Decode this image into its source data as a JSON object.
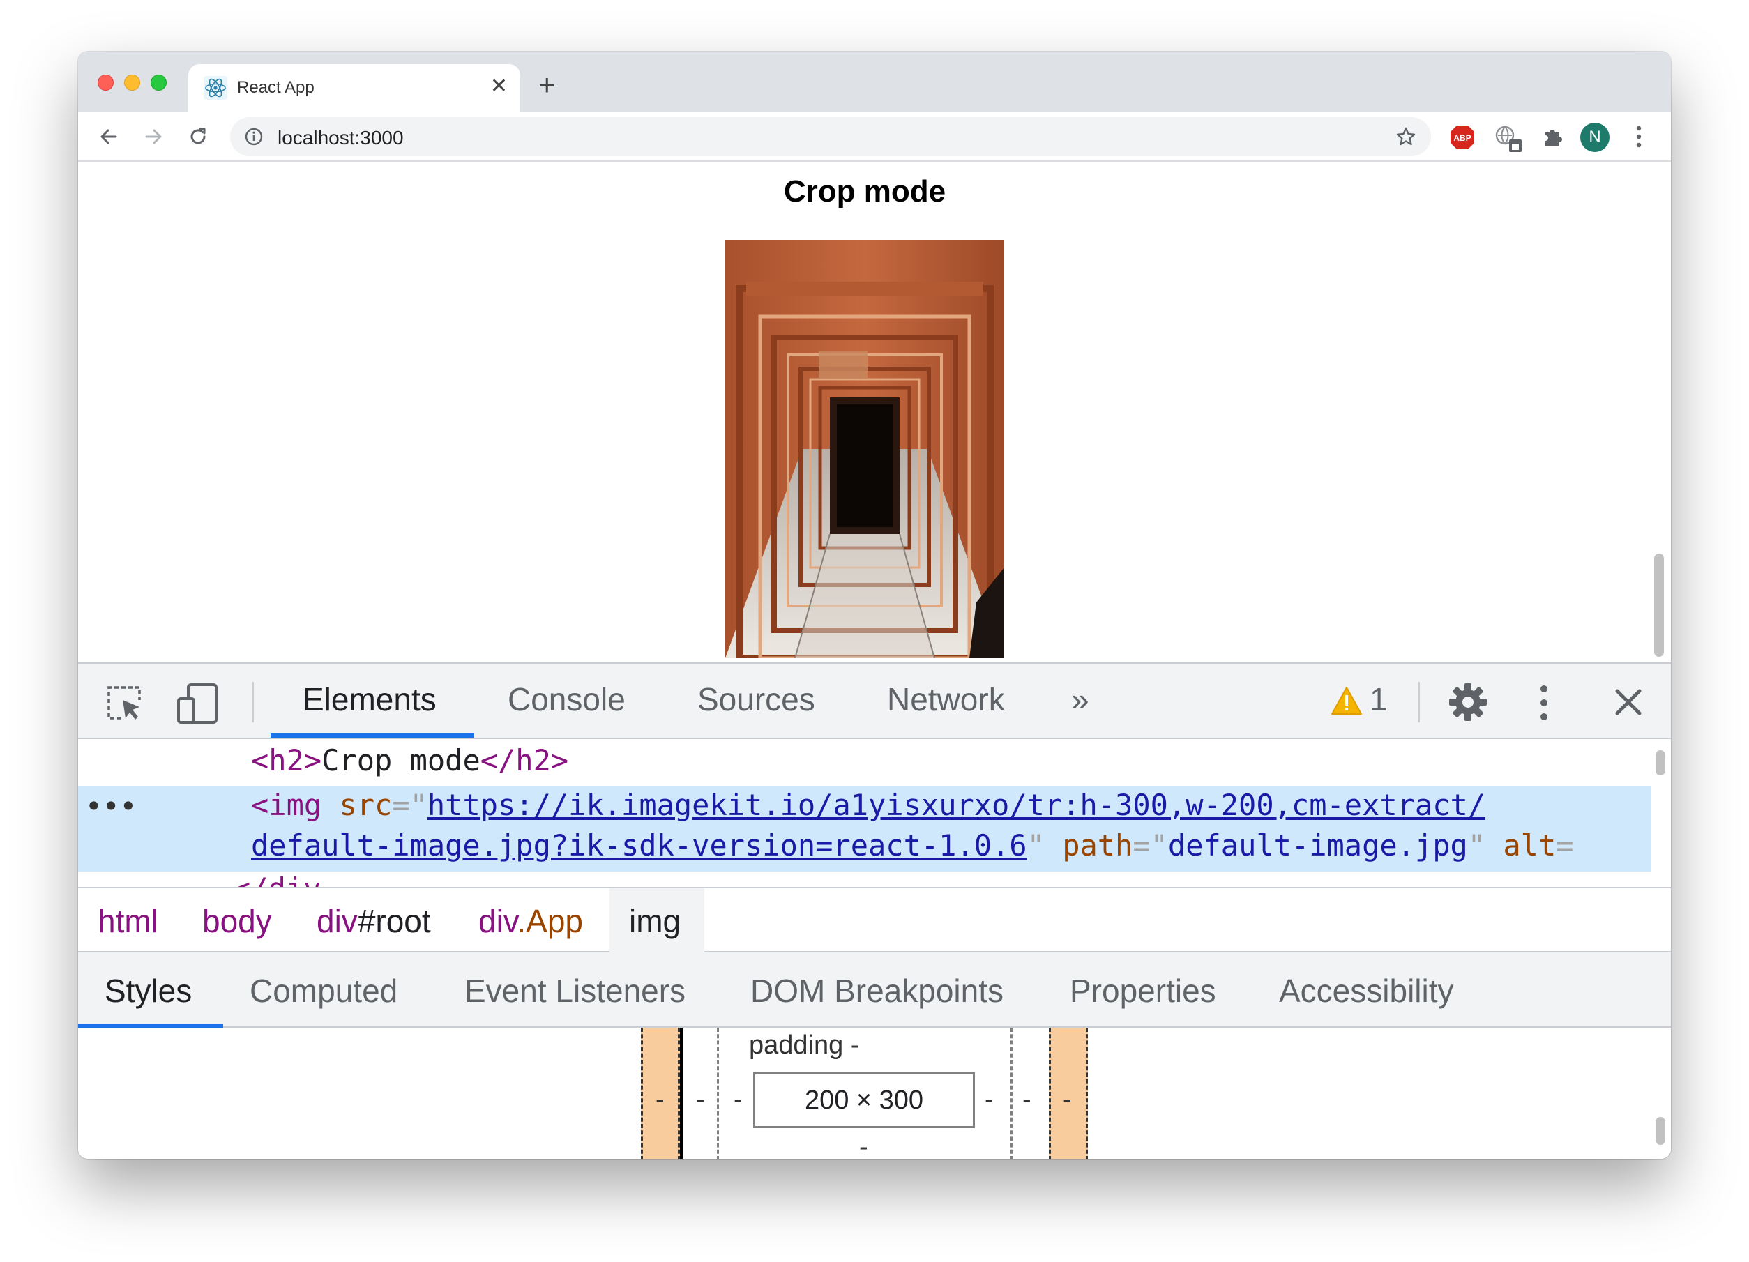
{
  "browser": {
    "tab_title": "React App",
    "tab_favicon": "react-logo-icon",
    "url": "localhost:3000",
    "extensions": [
      "adblock-plus-icon",
      "translate-extension-icon",
      "puzzle-extensions-icon"
    ],
    "avatar_letter": "N",
    "abp_label": "ABP"
  },
  "page": {
    "heading": "Crop mode"
  },
  "devtools": {
    "tabs": [
      "Elements",
      "Console",
      "Sources",
      "Network"
    ],
    "active_tab": "Elements",
    "more_tabs": "»",
    "warning_count": "1",
    "dom": {
      "line1_open": "<h2>",
      "line1_text": "Crop mode",
      "line1_close": "</h2>",
      "ellipsis": "•••",
      "img_open": "<img",
      "src_attr": "src",
      "src_url_line1": "https://ik.imagekit.io/a1yisxurxo/tr:h-300,w-200,cm-extract/",
      "src_url_line2": "default-image.jpg?ik-sdk-version=react-1.0.6",
      "path_attr": "path",
      "path_val": "default-image.jpg",
      "alt_attr": "alt",
      "partial_line": "</div"
    },
    "breadcrumbs": {
      "html": "html",
      "body": "body",
      "root_tag": "div",
      "root_id": "#root",
      "app_tag": "div",
      "app_class": ".App",
      "img": "img"
    },
    "subtabs": [
      "Styles",
      "Computed",
      "Event Listeners",
      "DOM Breakpoints",
      "Properties",
      "Accessibility"
    ],
    "active_subtab": "Styles",
    "box_model": {
      "padding_label": "padding -",
      "dash": "-",
      "content_size": "200 × 300"
    }
  },
  "colors": {
    "accent": "#1a73e8",
    "selected_row": "#cfe8fc",
    "margin_fill": "#f9cc9d",
    "tag": "#881280",
    "attr": "#994500",
    "value": "#1a1aa6"
  }
}
